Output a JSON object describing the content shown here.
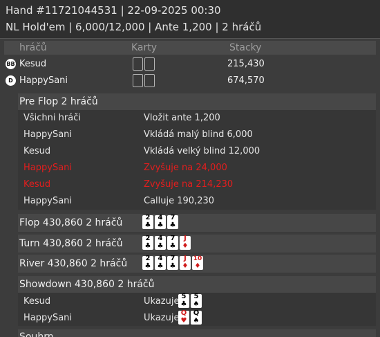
{
  "header": {
    "line1": "Hand #11721044531   | 22-09-2025 00:30",
    "line2": "NL Hold'em | 6,000/12,000 | Ante 1,200 | 2 hráčů"
  },
  "columns": {
    "players": "hráčů",
    "cards": "Karty",
    "stacks": "Stacky"
  },
  "players": [
    {
      "position": "BB",
      "name": "Kesud",
      "stack": "215,430"
    },
    {
      "position": "D",
      "name": "HappySani",
      "stack": "674,570"
    }
  ],
  "preflop": {
    "title": "Pre Flop  2 hráčů",
    "actions": [
      {
        "name": "Všichni hráči",
        "action": "Vložit ante 1,200",
        "highlight": false
      },
      {
        "name": "HappySani",
        "action": "Vkládá malý blind 6,000",
        "highlight": false
      },
      {
        "name": "Kesud",
        "action": "Vkládá velký blind 12,000",
        "highlight": false
      },
      {
        "name": "HappySani",
        "action": "Zvyšuje na 24,000",
        "highlight": true
      },
      {
        "name": "Kesud",
        "action": "Zvyšuje na 214,230",
        "highlight": true
      },
      {
        "name": "HappySani",
        "action": "Calluje 190,230",
        "highlight": false
      }
    ]
  },
  "streets": [
    {
      "title": "Flop  430,860  2 hráčů",
      "cards": [
        {
          "rank": "2",
          "suit": "♣"
        },
        {
          "rank": "4",
          "suit": "♣"
        },
        {
          "rank": "7",
          "suit": "♣"
        }
      ]
    },
    {
      "title": "Turn  430,860  2 hráčů",
      "cards": [
        {
          "rank": "2",
          "suit": "♣"
        },
        {
          "rank": "4",
          "suit": "♣"
        },
        {
          "rank": "7",
          "suit": "♣"
        },
        {
          "rank": "J",
          "suit": "♦"
        }
      ]
    },
    {
      "title": "River  430,860  2 hráčů",
      "cards": [
        {
          "rank": "2",
          "suit": "♣"
        },
        {
          "rank": "4",
          "suit": "♣"
        },
        {
          "rank": "7",
          "suit": "♣"
        },
        {
          "rank": "J",
          "suit": "♦"
        },
        {
          "rank": "10",
          "suit": "♦"
        }
      ]
    }
  ],
  "showdown": {
    "title": "Showdown  430,860  2 hráčů",
    "rows": [
      {
        "name": "Kesud",
        "label": "Ukazuje",
        "cards": [
          {
            "rank": "5",
            "suit": "♣"
          },
          {
            "rank": "5",
            "suit": "♠"
          }
        ]
      },
      {
        "name": "HappySani",
        "label": "Ukazuje",
        "cards": [
          {
            "rank": "Q",
            "suit": "♥"
          },
          {
            "rank": "Q",
            "suit": "♠"
          }
        ]
      }
    ]
  },
  "bottom_label": "Souhrn",
  "colors": {
    "red_action": "#e21e1e",
    "background": "#3c3c3c",
    "header": "#2f2f2f"
  }
}
